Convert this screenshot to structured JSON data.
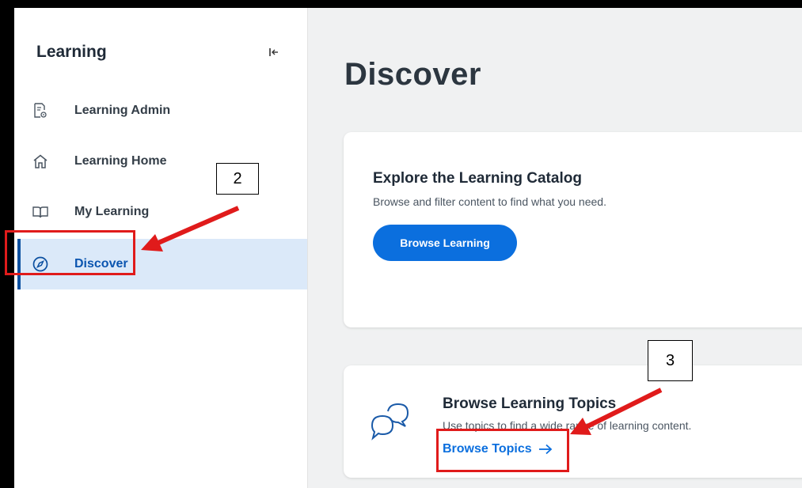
{
  "sidebar": {
    "title": "Learning",
    "collapse_icon": "collapse-left-icon",
    "items": [
      {
        "label": "Learning Admin",
        "icon": "admin-report-icon"
      },
      {
        "label": "Learning Home",
        "icon": "home-icon"
      },
      {
        "label": "My Learning",
        "icon": "book-icon"
      },
      {
        "label": "Discover",
        "icon": "compass-icon",
        "active": true
      }
    ]
  },
  "main": {
    "title": "Discover",
    "catalog_card": {
      "title": "Explore the Learning Catalog",
      "description": "Browse and filter content to find what you need.",
      "button_label": "Browse Learning"
    },
    "topics_card": {
      "icon": "chat-bubbles-icon",
      "title": "Browse Learning Topics",
      "description": "Use topics to find a wide range of learning content.",
      "link_label": "Browse Topics"
    }
  },
  "annotations": {
    "step2_label": "2",
    "step3_label": "3",
    "color": "#e01b1b"
  },
  "colors": {
    "accent": "#0b6fde",
    "active_bg": "#dbe9f9",
    "main_bg": "#f0f1f2"
  }
}
